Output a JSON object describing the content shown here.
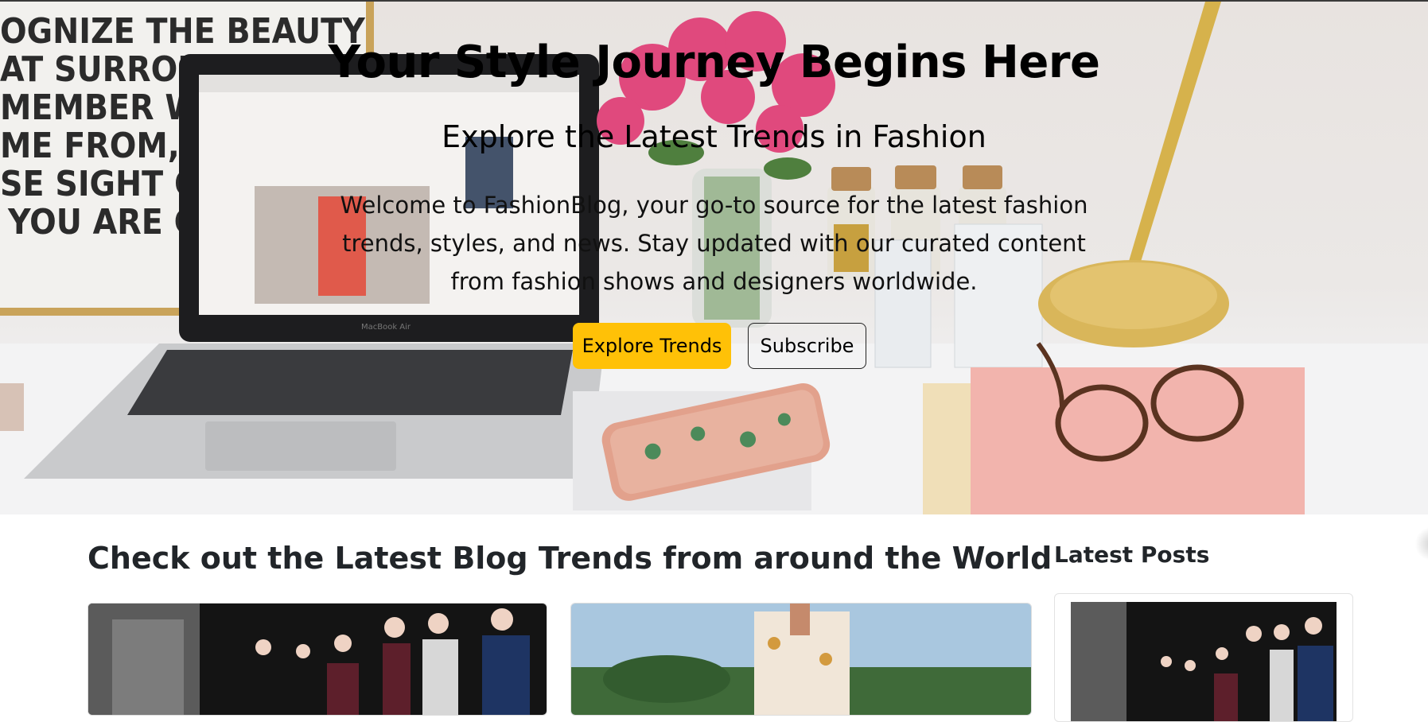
{
  "hero": {
    "title": "Your Style Journey Begins Here",
    "subtitle": "Explore the Latest Trends in Fashion",
    "description": "Welcome to FashionBlog, your go-to source for the latest fashion trends, styles, and news. Stay updated with our curated content from fashion shows and designers worldwide.",
    "primary_button": "Explore Trends",
    "secondary_button": "Subscribe",
    "poster_lines": [
      "OGNIZE THE BEAUTY",
      "AT SURROUNDS",
      "MEMBER WHERE",
      "ME FROM, BUT",
      "SE SIGHT OF",
      "YOU ARE GO"
    ],
    "laptop_label": "MacBook Air"
  },
  "main": {
    "section_title": "Check out the Latest Blog Trends from around the World"
  },
  "sidebar": {
    "title": "Latest Posts"
  },
  "colors": {
    "accent": "#ffc107",
    "text": "#212529"
  }
}
